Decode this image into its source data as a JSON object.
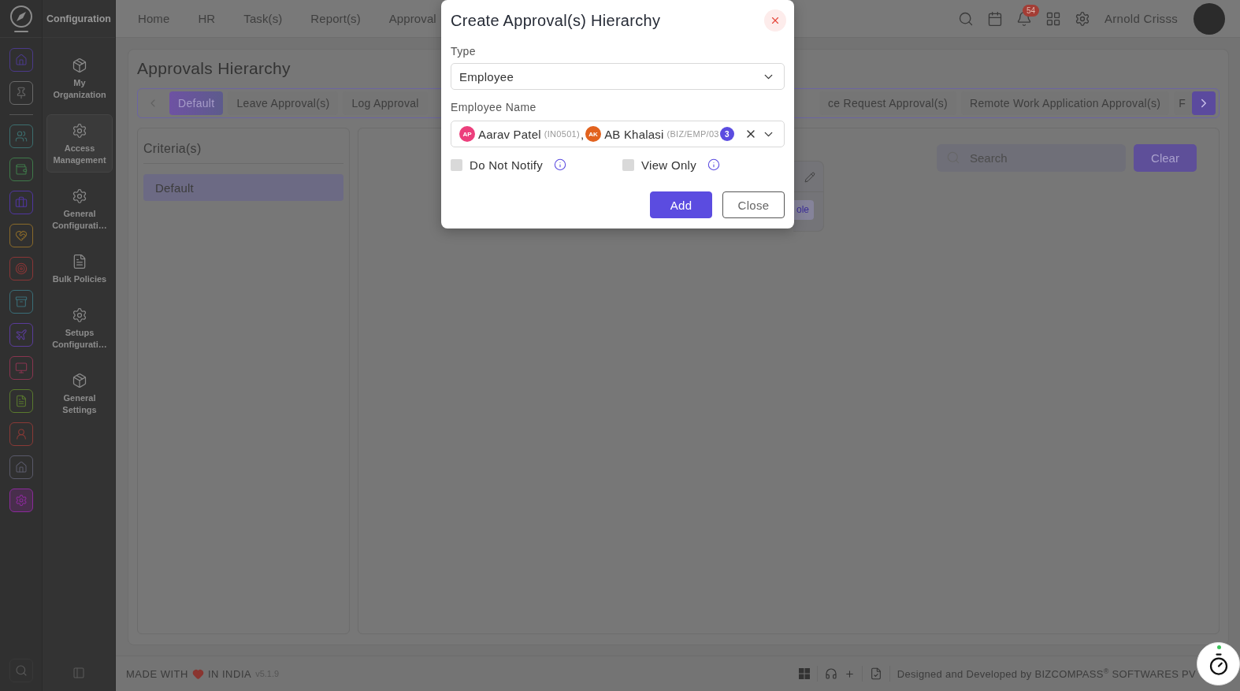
{
  "rail": {
    "pinned": [
      {
        "color": "#4b3a8a",
        "selected": false
      },
      {
        "color": "#6a6a6a",
        "selected": false
      }
    ],
    "modules": [
      {
        "color": "#3c6e6e",
        "selected": false
      },
      {
        "color": "#3f7a4a",
        "selected": false
      },
      {
        "color": "#5036a0",
        "selected": false
      },
      {
        "color": "#8a6a2a",
        "selected": false
      },
      {
        "color": "#8a3636",
        "selected": false
      },
      {
        "color": "#3a6e78",
        "selected": false
      },
      {
        "color": "#5a3c9a",
        "selected": false
      },
      {
        "color": "#8a3550",
        "selected": false
      },
      {
        "color": "#5a7a2e",
        "selected": false
      },
      {
        "color": "#8a3a36",
        "selected": false
      },
      {
        "color": "#5a5a6a",
        "selected": false
      },
      {
        "color": "#8a2a9a",
        "selected": true
      }
    ]
  },
  "sidebar": {
    "title": "Configuration",
    "items": [
      {
        "label": "My Organization",
        "selected": false
      },
      {
        "label": "Access Management",
        "selected": true
      },
      {
        "label": "General Configurati…",
        "selected": false
      },
      {
        "label": "Bulk Policies",
        "selected": false
      },
      {
        "label": "Setups Configurati…",
        "selected": false
      },
      {
        "label": "General Settings",
        "selected": false
      }
    ]
  },
  "header": {
    "nav": [
      "Home",
      "HR",
      "Task(s)",
      "Report(s)",
      "Approval"
    ],
    "notification_count": "54",
    "user_name": "Arnold Crisss"
  },
  "page": {
    "title": "Approvals Hierarchy",
    "tabs": [
      {
        "label": "Default",
        "selected": true
      },
      {
        "label": "Leave Approval(s)",
        "selected": false
      },
      {
        "label": "Log Approval",
        "selected": false
      },
      {
        "label": "ce Request Approval(s)",
        "selected": false
      },
      {
        "label": "Remote Work Application Approval(s)",
        "selected": false
      },
      {
        "label": "F",
        "selected": false
      }
    ]
  },
  "criteria": {
    "title": "Criteria(s)",
    "items": [
      {
        "label": "Default",
        "selected": true
      }
    ]
  },
  "results": {
    "search": {
      "placeholder": "Search"
    },
    "clear_button": "Clear",
    "card": {
      "link": "ole"
    }
  },
  "footer": {
    "made_with": "MADE WITH",
    "in_india": "IN INDIA",
    "version": "v5.1.9",
    "credit": "Designed and Developed by BIZCOMPASS$^{®}$ SOFTWARES PV"
  },
  "modal": {
    "title": "Create Approval(s) Hierarchy",
    "type_field": {
      "label": "Type",
      "value": "Employee"
    },
    "employee_field": {
      "label": "Employee Name",
      "chips": [
        {
          "initials": "AP",
          "name": "Aarav Patel",
          "code": "(IN0501)",
          "color": "#ec3f7c"
        },
        {
          "initials": "AK",
          "name": "AB Khalasi",
          "code": "(BIZ/EMP/03",
          "color": "#e2621e"
        }
      ],
      "separator": ",",
      "more_count": "3"
    },
    "options": [
      {
        "label": "Do Not Notify",
        "checked": false
      },
      {
        "label": "View Only",
        "checked": false
      }
    ],
    "buttons": [
      {
        "label": "Add",
        "kind": "primary"
      },
      {
        "label": "Close",
        "kind": "secondary"
      }
    ]
  }
}
